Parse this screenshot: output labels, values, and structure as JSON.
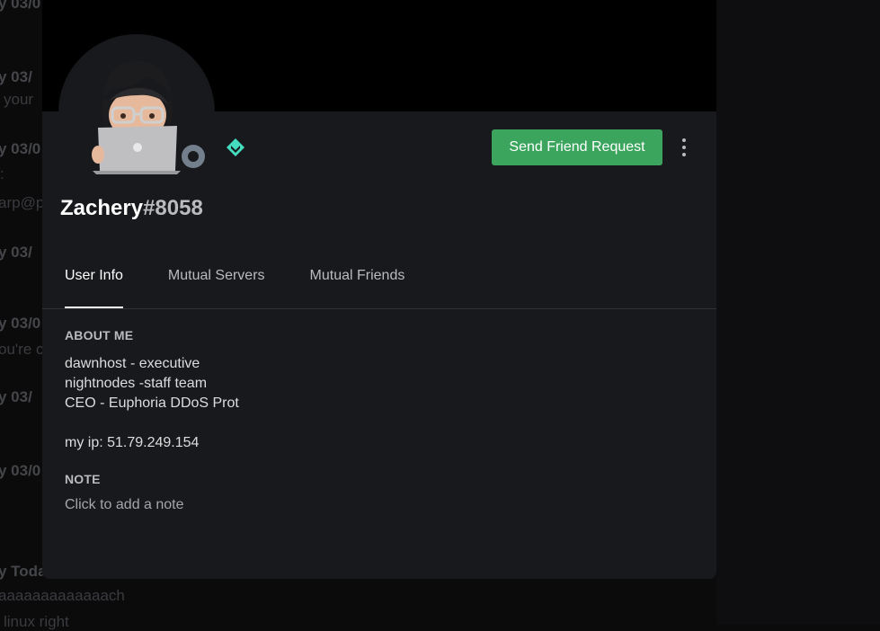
{
  "background_chat": {
    "lines": [
      {
        "text": "y  03/0",
        "style": "strong"
      },
      {
        "text": "y  03/",
        "style": "strong"
      },
      {
        "text": "your",
        "style": "normal"
      },
      {
        "text": "y  03/0",
        "style": "strong"
      },
      {
        "text": ":",
        "style": "normal"
      },
      {
        "text": "arp@p",
        "style": "normal"
      },
      {
        "text": "y  03/",
        "style": "strong"
      },
      {
        "text": "y  03/0",
        "style": "strong"
      },
      {
        "text": "ou're c",
        "style": "normal"
      },
      {
        "text": "y  03/",
        "style": "strong"
      },
      {
        "text": "y  03/0",
        "style": "strong"
      },
      {
        "text": "",
        "style": "normal"
      },
      {
        "text": "y  Toda",
        "style": "strong"
      },
      {
        "text": "aaaaaaaaaaaaach",
        "style": "normal"
      },
      {
        "text": "linux right",
        "style": "normal"
      }
    ]
  },
  "profile": {
    "username": "Zachery",
    "discriminator": "#8058",
    "avatar_icon": "memoji-laptop-avatar",
    "status": "offline",
    "badge_icon": "hypesquad-balance-icon",
    "send_friend_request_label": "Send Friend Request",
    "more_icon": "vertical-ellipsis-icon"
  },
  "tabs": [
    {
      "label": "User Info",
      "active": true
    },
    {
      "label": "Mutual Servers",
      "active": false
    },
    {
      "label": "Mutual Friends",
      "active": false
    }
  ],
  "about_me": {
    "title": "ABOUT ME",
    "lines": [
      "dawnhost - executive",
      "nightnodes -staff team",
      "CEO - Euphoria DDoS Prot",
      "",
      "my ip: 51.79.249.154"
    ]
  },
  "note": {
    "title": "NOTE",
    "placeholder": "Click to add a note"
  },
  "colors": {
    "modal_bg": "#18191c",
    "banner": "#000000",
    "accent_green": "#3ba55d",
    "badge_teal": "#45ddc0",
    "status_offline": "#747f8d"
  }
}
